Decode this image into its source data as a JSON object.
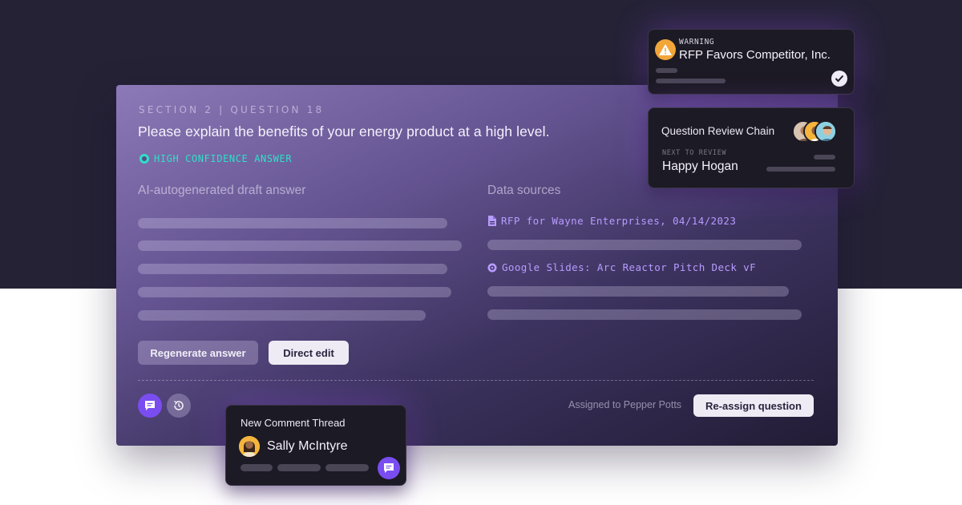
{
  "card": {
    "section_label": "SECTION 2 | QUESTION 18",
    "question": "Please explain the benefits of your energy product at a high level.",
    "confidence_label": "HIGH CONFIDENCE ANSWER",
    "draft_heading": "AI-autogenerated draft answer",
    "sources_heading": "Data sources",
    "sources": [
      {
        "label": "RFP for Wayne Enterprises, 04/14/2023",
        "icon": "document-icon"
      },
      {
        "label": "Google Slides: Arc Reactor Pitch Deck vF",
        "icon": "slides-icon"
      }
    ],
    "buttons": {
      "regenerate": "Regenerate answer",
      "direct_edit": "Direct edit",
      "reassign": "Re-assign question"
    },
    "assigned_text": "Assigned to Pepper Potts"
  },
  "warning_panel": {
    "kicker": "WARNING",
    "title": "RFP Favors Competitor, Inc."
  },
  "review_panel": {
    "title": "Question Review Chain",
    "kicker": "NEXT TO REVIEW",
    "name": "Happy Hogan"
  },
  "comment_panel": {
    "title": "New Comment Thread",
    "name": "Sally McIntyre"
  },
  "colors": {
    "accent_purple": "#7a4df0",
    "confidence_teal": "#2ee0c8",
    "source_link": "#b79cff",
    "warning_orange": "#f2a63a"
  }
}
